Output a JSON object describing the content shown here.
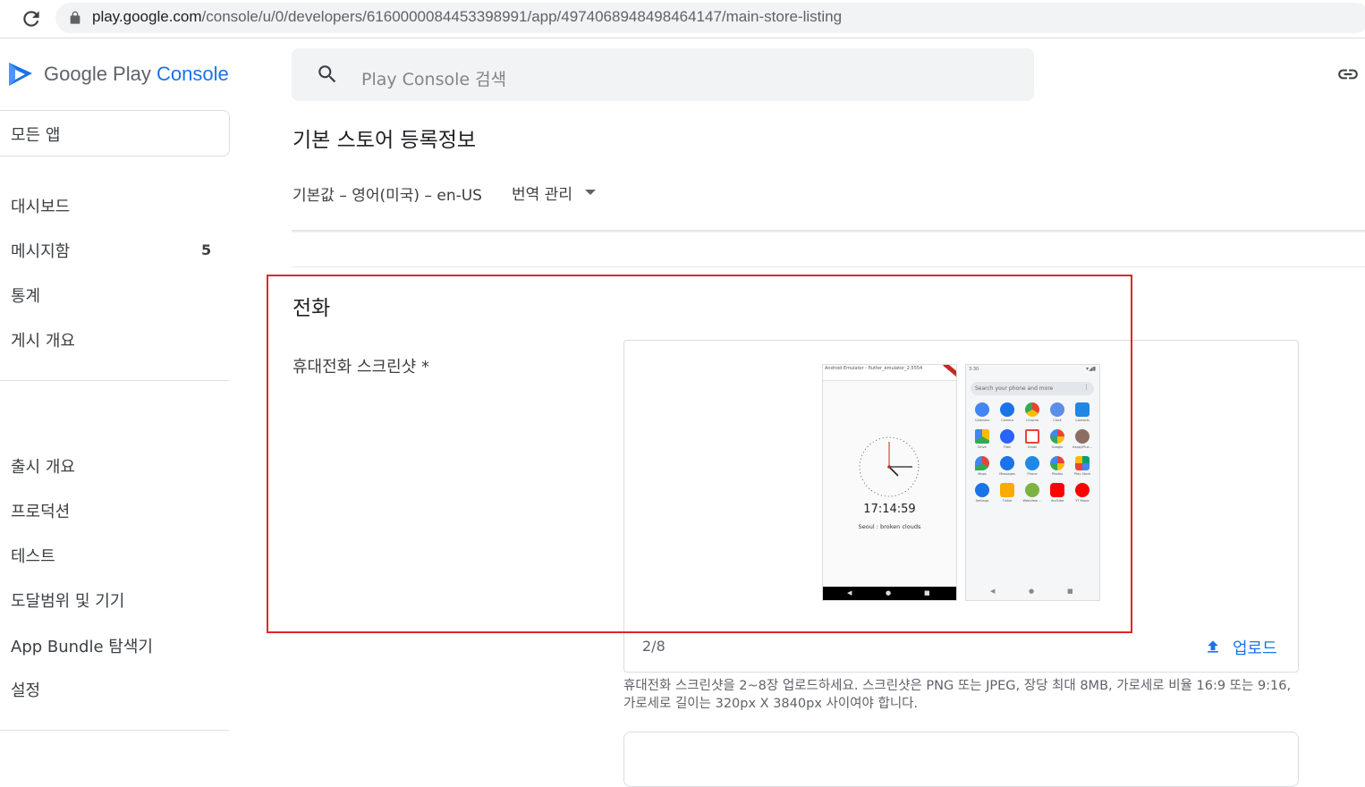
{
  "browser": {
    "url_host": "play.google.com",
    "url_path": "/console/u/0/developers/6160000084453398991/app/4974068948498464147/main-store-listing"
  },
  "logo": {
    "prefix": "Google Play",
    "accent": "Console"
  },
  "sidebar": {
    "all_apps": "모든 앱",
    "items": [
      {
        "label": "대시보드"
      },
      {
        "label": "메시지함",
        "badge": "5"
      },
      {
        "label": "통계"
      },
      {
        "label": "게시 개요"
      },
      {
        "label": "출시 개요"
      },
      {
        "label": "프로덕션"
      },
      {
        "label": "테스트"
      },
      {
        "label": "도달범위 및 기기"
      },
      {
        "label": "App Bundle 탐색기"
      },
      {
        "label": "설정"
      }
    ]
  },
  "search": {
    "placeholder": "Play Console 검색"
  },
  "page": {
    "title": "기본 스토어 등록정보",
    "locale": "기본값 – 영어(미국) – en-US",
    "translate": "번역 관리"
  },
  "phone_section": {
    "title": "전화",
    "field_label": "휴대전화 스크린샷",
    "required_mark": "*",
    "count": "2/8",
    "upload": "업로드",
    "hint": "휴대전화 스크린샷을 2~8장 업로드하세요. 스크린샷은 PNG 또는 JPEG, 장당 최대 8MB, 가로세로 비율 16:9 또는 9:16, 가로세로 길이는 320px X 3840px 사이여야 합니다."
  },
  "screenshot1": {
    "topbar": "Android Emulator - flutter_emulator_2:5554",
    "time": "17:14:59",
    "weather": "Seoul : broken clouds"
  },
  "screenshot2": {
    "status_time": "3:30",
    "search_text": "Search your phone and more",
    "apps": [
      {
        "label": "Calendar",
        "color": "#4285f4"
      },
      {
        "label": "Camera",
        "color": "#1a73e8"
      },
      {
        "label": "Chrome",
        "color": "#34a853"
      },
      {
        "label": "Clock",
        "color": "#5c8de8"
      },
      {
        "label": "Contacts",
        "color": "#1e88e5"
      },
      {
        "label": "Drive",
        "color": "#fbbc04"
      },
      {
        "label": "Files",
        "color": "#2962ff"
      },
      {
        "label": "Gmail",
        "color": "#ea4335"
      },
      {
        "label": "Google",
        "color": "#4285f4"
      },
      {
        "label": "happyPlus...",
        "color": "#8d6e63"
      },
      {
        "label": "Maps",
        "color": "#34a853"
      },
      {
        "label": "Messages",
        "color": "#1a73e8"
      },
      {
        "label": "Phone",
        "color": "#1e88e5"
      },
      {
        "label": "Photos",
        "color": "#fbbc04"
      },
      {
        "label": "Play Store",
        "color": "#00a173"
      },
      {
        "label": "Settings",
        "color": "#1a73e8"
      },
      {
        "label": "Tinkle",
        "color": "#f9ab00"
      },
      {
        "label": "WebView ...",
        "color": "#7cb342"
      },
      {
        "label": "YouTube",
        "color": "#ff0000"
      },
      {
        "label": "YT Music",
        "color": "#ff0000"
      }
    ]
  },
  "colors": {
    "accent": "#1a73e8",
    "highlight": "#e3242b"
  }
}
